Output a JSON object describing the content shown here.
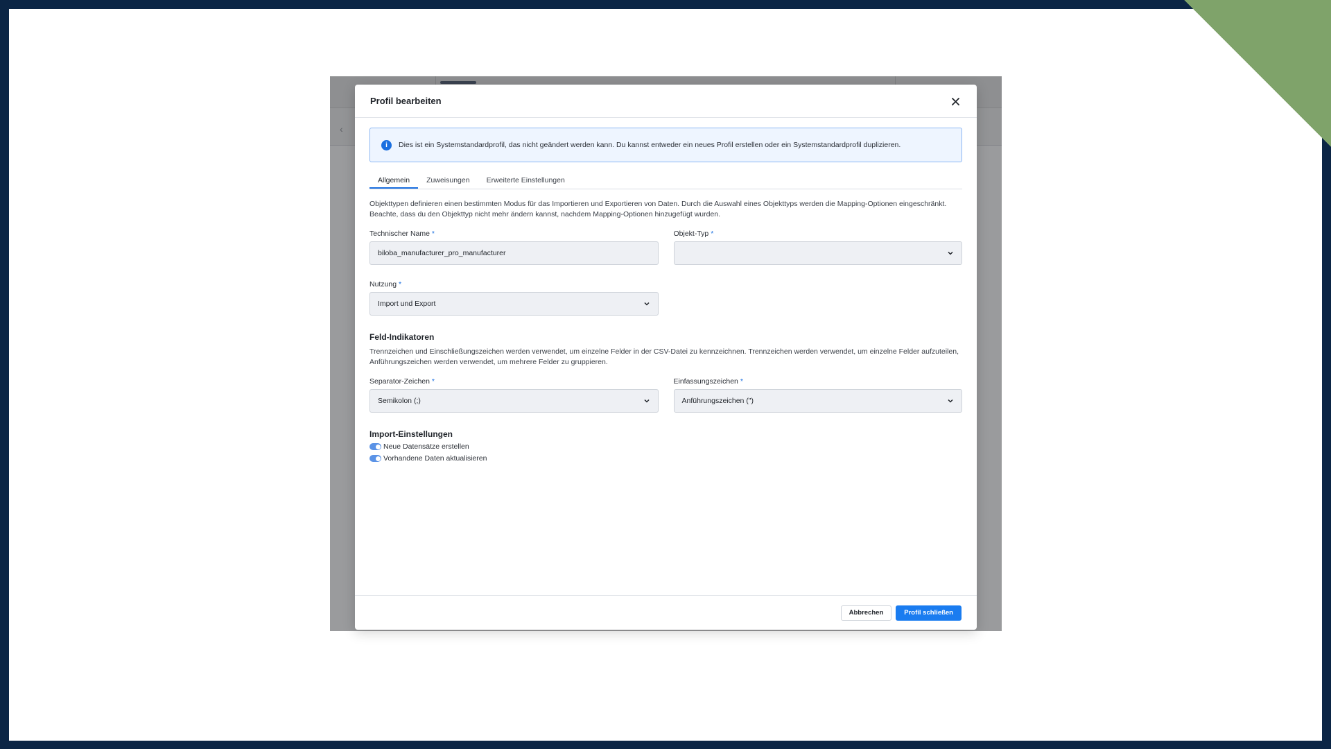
{
  "colors": {
    "accent": "#1a6fe0",
    "primary_button": "#1a7cf0",
    "frame": "#0b2545",
    "frame_corner": "#7fa36a"
  },
  "modal": {
    "title": "Profil bearbeiten",
    "close_icon": "close-icon",
    "info": {
      "icon": "info-icon",
      "icon_glyph": "i",
      "text": "Dies ist ein Systemstandardprofil, das nicht geändert werden kann. Du kannst entweder ein neues Profil erstellen oder ein Systemstandardprofil duplizieren."
    },
    "tabs": [
      {
        "label": "Allgemein",
        "active": true
      },
      {
        "label": "Zuweisungen",
        "active": false
      },
      {
        "label": "Erweiterte Einstellungen",
        "active": false
      }
    ],
    "description": "Objekttypen definieren einen bestimmten Modus für das Importieren und Exportieren von Daten. Durch die Auswahl eines Objekttyps werden die Mapping-Optionen eingeschränkt. Beachte, dass du den Objekttyp nicht mehr ändern kannst, nachdem Mapping-Optionen hinzugefügt wurden.",
    "fields": {
      "technical_name": {
        "label": "Technischer Name",
        "required_marker": "*",
        "value": "biloba_manufacturer_pro_manufacturer"
      },
      "object_type": {
        "label": "Objekt-Typ",
        "required_marker": "*",
        "value": ""
      },
      "usage": {
        "label": "Nutzung",
        "required_marker": "*",
        "value": "Import und Export"
      }
    },
    "field_indicators": {
      "title": "Feld-Indikatoren",
      "description": "Trennzeichen und Einschließungszeichen werden verwendet, um einzelne Felder in der CSV-Datei zu kennzeichnen. Trennzeichen werden verwendet, um einzelne Felder aufzuteilen, Anführungszeichen werden verwendet, um mehrere Felder zu gruppieren.",
      "separator": {
        "label": "Separator-Zeichen",
        "required_marker": "*",
        "value": "Semikolon (;)"
      },
      "enclosure": {
        "label": "Einfassungszeichen",
        "required_marker": "*",
        "value": "Anführungszeichen (\")"
      }
    },
    "import_settings": {
      "title": "Import-Einstellungen",
      "toggles": [
        {
          "label": "Neue Datensätze erstellen",
          "on": true
        },
        {
          "label": "Vorhandene Daten aktualisieren",
          "on": true
        }
      ]
    },
    "footer": {
      "cancel_label": "Abbrechen",
      "primary_label": "Profil schließen"
    }
  },
  "background_app": {
    "back_icon": "chevron-left-icon",
    "back_glyph": "‹"
  }
}
